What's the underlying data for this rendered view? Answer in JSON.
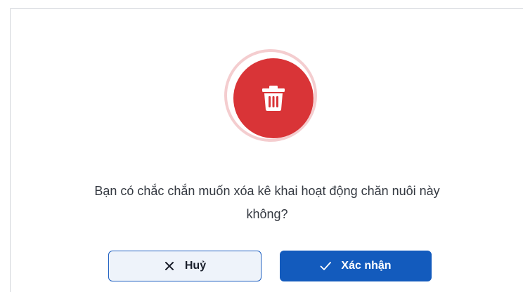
{
  "dialog": {
    "icon": "trash-icon",
    "message_line1": "Bạn có chắc chắn muốn xóa kê khai hoạt động chăn nuôi này",
    "message_line2": "không?",
    "cancel_icon": "close-icon",
    "cancel_label": "Huỷ",
    "confirm_icon": "check-icon",
    "confirm_label": "Xác nhận"
  },
  "colors": {
    "danger": "#d93437",
    "primary": "#135bbd",
    "cancel_bg": "#eef3fa"
  }
}
